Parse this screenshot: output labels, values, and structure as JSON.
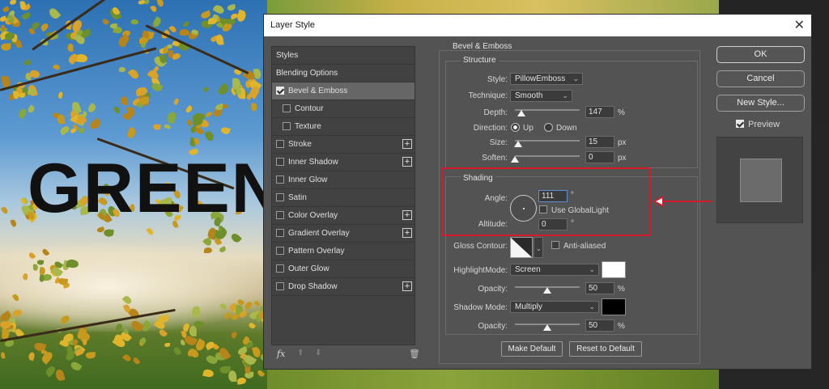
{
  "background": {
    "headline": "GREEN"
  },
  "dialog": {
    "title": "Layer Style",
    "close": "✕"
  },
  "styles_panel": {
    "items": [
      {
        "label": "Styles",
        "checkbox": false,
        "checked": false,
        "plus": false,
        "active": false,
        "indent": 0
      },
      {
        "label": "Blending Options",
        "checkbox": false,
        "checked": false,
        "plus": false,
        "active": false,
        "indent": 0
      },
      {
        "label": "Bevel & Emboss",
        "checkbox": true,
        "checked": true,
        "plus": false,
        "active": true,
        "indent": 0
      },
      {
        "label": "Contour",
        "checkbox": true,
        "checked": false,
        "plus": false,
        "active": false,
        "indent": 1
      },
      {
        "label": "Texture",
        "checkbox": true,
        "checked": false,
        "plus": false,
        "active": false,
        "indent": 1
      },
      {
        "label": "Stroke",
        "checkbox": true,
        "checked": false,
        "plus": true,
        "active": false,
        "indent": 0
      },
      {
        "label": "Inner Shadow",
        "checkbox": true,
        "checked": false,
        "plus": true,
        "active": false,
        "indent": 0
      },
      {
        "label": "Inner Glow",
        "checkbox": true,
        "checked": false,
        "plus": false,
        "active": false,
        "indent": 0
      },
      {
        "label": "Satin",
        "checkbox": true,
        "checked": false,
        "plus": false,
        "active": false,
        "indent": 0
      },
      {
        "label": "Color Overlay",
        "checkbox": true,
        "checked": false,
        "plus": true,
        "active": false,
        "indent": 0
      },
      {
        "label": "Gradient Overlay",
        "checkbox": true,
        "checked": false,
        "plus": true,
        "active": false,
        "indent": 0
      },
      {
        "label": "Pattern Overlay",
        "checkbox": true,
        "checked": false,
        "plus": false,
        "active": false,
        "indent": 0
      },
      {
        "label": "Outer Glow",
        "checkbox": true,
        "checked": false,
        "plus": false,
        "active": false,
        "indent": 0
      },
      {
        "label": "Drop Shadow",
        "checkbox": true,
        "checked": false,
        "plus": true,
        "active": false,
        "indent": 0
      }
    ],
    "footer": {
      "fx": "fx",
      "up": "⬆",
      "down": "⬇",
      "trash": "🗑"
    }
  },
  "bevel": {
    "section_title": "Bevel & Emboss",
    "structure": {
      "title": "Structure",
      "style_label": "Style:",
      "style_value": "PillowEmboss",
      "technique_label": "Technique:",
      "technique_value": "Smooth",
      "depth_label": "Depth:",
      "depth_value": "147",
      "depth_unit": "%",
      "depth_slider": 0.1,
      "direction_label": "Direction:",
      "direction_up": "Up",
      "direction_down": "Down",
      "direction_selected": "Up",
      "size_label": "Size:",
      "size_value": "15",
      "size_unit": "px",
      "size_slider": 0.05,
      "soften_label": "Soften:",
      "soften_value": "0",
      "soften_unit": "px",
      "soften_slider": 0.0
    },
    "shading": {
      "title": "Shading",
      "angle_label": "Angle:",
      "angle_value": "111",
      "angle_unit": "°",
      "use_global_light": "Use GlobalLight",
      "use_global_light_checked": false,
      "altitude_label": "Altitude:",
      "altitude_value": "0",
      "altitude_unit": "°",
      "gloss_contour_label": "Gloss Contour:",
      "anti_aliased": "Anti-aliased",
      "anti_aliased_checked": false,
      "highlight_mode_label": "HighlightMode:",
      "highlight_mode_value": "Screen",
      "highlight_color": "#ffffff",
      "highlight_opacity_label": "Opacity:",
      "highlight_opacity_value": "50",
      "highlight_opacity_unit": "%",
      "highlight_opacity_slider": 0.5,
      "shadow_mode_label": "Shadow Mode:",
      "shadow_mode_value": "Multiply",
      "shadow_color": "#000000",
      "shadow_opacity_label": "Opacity:",
      "shadow_opacity_value": "50",
      "shadow_opacity_unit": "%",
      "shadow_opacity_slider": 0.5
    },
    "make_default": "Make Default",
    "reset_to_default": "Reset to Default"
  },
  "actions": {
    "ok": "OK",
    "cancel": "Cancel",
    "new_style": "New Style...",
    "preview_label": "Preview",
    "preview_checked": true
  },
  "annotation": {
    "highlight_color": "#d61a2b"
  }
}
